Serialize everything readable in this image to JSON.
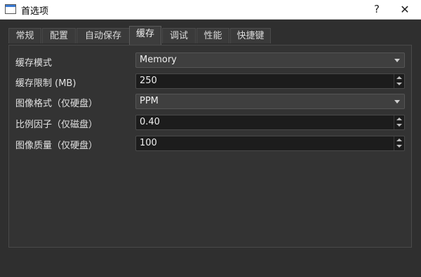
{
  "window": {
    "title": "首选项",
    "help": "?",
    "close": "✕"
  },
  "tabs": [
    {
      "label": "常规"
    },
    {
      "label": "配置"
    },
    {
      "label": "自动保存"
    },
    {
      "label": "缓存"
    },
    {
      "label": "调试"
    },
    {
      "label": "性能"
    },
    {
      "label": "快捷键"
    }
  ],
  "active_tab": "缓存",
  "settings": {
    "cache_mode": {
      "label": "缓存模式",
      "value": "Memory"
    },
    "cache_limit": {
      "label": "缓存限制 (MB)",
      "value": "250"
    },
    "image_format": {
      "label": "图像格式（仅硬盘）",
      "value": "PPM"
    },
    "scale_factor": {
      "label": "比例因子（仅磁盘）",
      "value": "0.40"
    },
    "image_quality": {
      "label": "图像质量（仅硬盘）",
      "value": "100"
    }
  }
}
